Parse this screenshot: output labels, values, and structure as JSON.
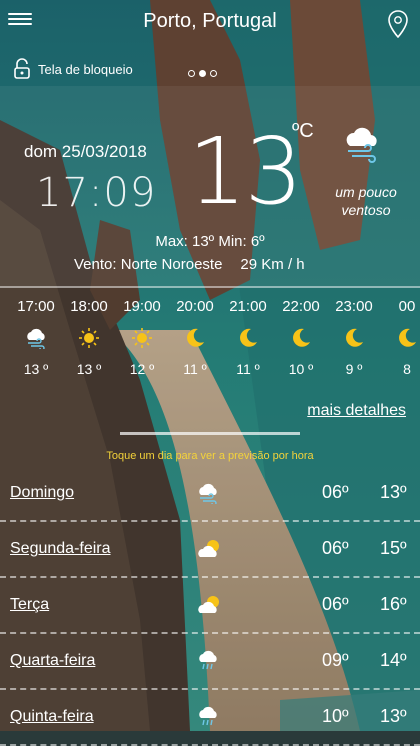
{
  "header": {
    "location": "Porto, Portugal",
    "lock_label": "Tela de bloqueio",
    "page_dots": 3,
    "active_dot": 1
  },
  "current": {
    "date": "dom 25/03/2018",
    "time": "17:09",
    "temperature": "13",
    "unit": "ºC",
    "condition_line1": "um pouco",
    "condition_line2": "ventoso",
    "condition_icon": "cloud-wind-icon",
    "maxmin": "Max: 13º  Min: 6º",
    "wind_label": "Vento: Norte Noroeste",
    "wind_speed": "29 Km / h"
  },
  "hourly": [
    {
      "time": "17:00",
      "icon": "cloud-wind-icon",
      "temp": "13 º"
    },
    {
      "time": "18:00",
      "icon": "sun-icon",
      "temp": "13 º"
    },
    {
      "time": "19:00",
      "icon": "sun-icon",
      "temp": "12 º"
    },
    {
      "time": "20:00",
      "icon": "moon-icon",
      "temp": "11 º"
    },
    {
      "time": "21:00",
      "icon": "moon-icon",
      "temp": "11 º"
    },
    {
      "time": "22:00",
      "icon": "moon-icon",
      "temp": "10 º"
    },
    {
      "time": "23:00",
      "icon": "moon-icon",
      "temp": "9 º"
    },
    {
      "time": "00",
      "icon": "moon-icon",
      "temp": "8"
    }
  ],
  "details_link": "mais detalhes",
  "hint": "Toque um dia para ver a previsão por hora",
  "daily": [
    {
      "name": "Domingo",
      "icon": "cloud-wind-icon",
      "min": "06º",
      "max": "13º"
    },
    {
      "name": "Segunda-feira",
      "icon": "partly-cloudy-icon",
      "min": "06º",
      "max": "15º"
    },
    {
      "name": "Terça",
      "icon": "partly-cloudy-icon",
      "min": "06º",
      "max": "16º"
    },
    {
      "name": "Quarta-feira",
      "icon": "rain-icon",
      "min": "09º",
      "max": "14º"
    },
    {
      "name": "Quinta-feira",
      "icon": "rain-icon",
      "min": "10º",
      "max": "13º"
    }
  ],
  "colors": {
    "hint": "#f4d33a",
    "sun": "#f7c318",
    "text": "#ffffff"
  }
}
